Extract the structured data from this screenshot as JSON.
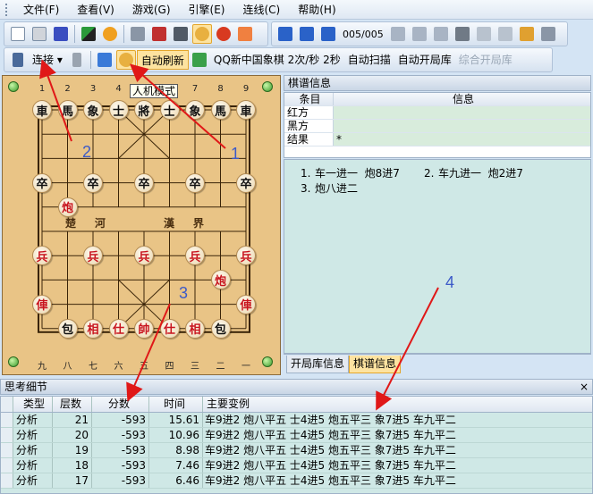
{
  "menu": [
    "文件(F)",
    "查看(V)",
    "游戏(G)",
    "引擎(E)",
    "连线(C)",
    "帮助(H)"
  ],
  "toolbar1": {
    "icons": [
      "new-icon",
      "open-icon",
      "save-icon",
      "board-flip-icon",
      "clock-icon",
      "window-icon",
      "window2-icon",
      "window3-icon",
      "zoom-icon",
      "stop-icon",
      "pause-icon"
    ]
  },
  "nav": {
    "counter": "005/005",
    "icons": [
      "first-icon",
      "prev-fast-icon",
      "prev-icon",
      "next-icon",
      "next-fast-icon",
      "last-icon",
      "tool-icon",
      "copy-icon",
      "paste-icon",
      "paste2-icon",
      "settings-icon"
    ]
  },
  "toolbar2": {
    "connect_label": "连接",
    "auto_refresh": "自动刷新",
    "qq_status": "QQ新中国象棋 2次/秒 2秒",
    "auto_scan": "自动扫描",
    "auto_open_book": "自动开局库",
    "combined_book": "综合开局库"
  },
  "board": {
    "tooltip": "人机模式",
    "top_files": [
      "1",
      "2",
      "3",
      "4",
      "5",
      "6",
      "7",
      "8",
      "9"
    ],
    "bottom_files": [
      "九",
      "八",
      "七",
      "六",
      "五",
      "四",
      "三",
      "二",
      "一"
    ],
    "river_left": [
      "楚",
      "河"
    ],
    "river_right": [
      "漢",
      "界"
    ],
    "pieces": [
      {
        "t": "車",
        "c": "black",
        "f": 0,
        "r": 0
      },
      {
        "t": "馬",
        "c": "black",
        "f": 1,
        "r": 0
      },
      {
        "t": "象",
        "c": "black",
        "f": 2,
        "r": 0
      },
      {
        "t": "士",
        "c": "black",
        "f": 3,
        "r": 0
      },
      {
        "t": "將",
        "c": "black",
        "f": 4,
        "r": 0
      },
      {
        "t": "士",
        "c": "black",
        "f": 5,
        "r": 0
      },
      {
        "t": "象",
        "c": "black",
        "f": 6,
        "r": 0
      },
      {
        "t": "馬",
        "c": "black",
        "f": 7,
        "r": 0
      },
      {
        "t": "車",
        "c": "black",
        "f": 8,
        "r": 0
      },
      {
        "t": "卒",
        "c": "black",
        "f": 0,
        "r": 3
      },
      {
        "t": "卒",
        "c": "black",
        "f": 2,
        "r": 3
      },
      {
        "t": "卒",
        "c": "black",
        "f": 4,
        "r": 3
      },
      {
        "t": "卒",
        "c": "black",
        "f": 6,
        "r": 3
      },
      {
        "t": "卒",
        "c": "black",
        "f": 8,
        "r": 3
      },
      {
        "t": "炮",
        "c": "red",
        "f": 1,
        "r": 4
      },
      {
        "t": "兵",
        "c": "red",
        "f": 0,
        "r": 6
      },
      {
        "t": "兵",
        "c": "red",
        "f": 2,
        "r": 6
      },
      {
        "t": "兵",
        "c": "red",
        "f": 4,
        "r": 6
      },
      {
        "t": "兵",
        "c": "red",
        "f": 6,
        "r": 6
      },
      {
        "t": "兵",
        "c": "red",
        "f": 8,
        "r": 6
      },
      {
        "t": "炮",
        "c": "red",
        "f": 7,
        "r": 7
      },
      {
        "t": "俥",
        "c": "red",
        "f": 0,
        "r": 8
      },
      {
        "t": "俥",
        "c": "red",
        "f": 8,
        "r": 8
      },
      {
        "t": "包",
        "c": "black",
        "f": 1,
        "r": 9
      },
      {
        "t": "相",
        "c": "red",
        "f": 2,
        "r": 9
      },
      {
        "t": "仕",
        "c": "red",
        "f": 3,
        "r": 9
      },
      {
        "t": "帥",
        "c": "red",
        "f": 4,
        "r": 9
      },
      {
        "t": "仕",
        "c": "red",
        "f": 5,
        "r": 9
      },
      {
        "t": "相",
        "c": "red",
        "f": 6,
        "r": 9
      },
      {
        "t": "包",
        "c": "black",
        "f": 7,
        "r": 9
      }
    ]
  },
  "record": {
    "title": "棋谱信息",
    "head_a": "条目",
    "head_b": "信息",
    "rows": [
      {
        "a": "红方",
        "b": ""
      },
      {
        "a": "黑方",
        "b": ""
      },
      {
        "a": "结果",
        "b": "*"
      }
    ],
    "moves": [
      {
        "n1": "1.",
        "m1": "车一进一",
        "m2": "炮8进7",
        "n2": "2.",
        "m3": "车九进一",
        "m4": "炮2进7"
      },
      {
        "n1": "3.",
        "m1": "炮八进二",
        "m2": "",
        "n2": "",
        "m3": "",
        "m4": ""
      }
    ],
    "tabs": [
      "开局库信息",
      "棋谱信息"
    ]
  },
  "analysis": {
    "title": "思考细节",
    "close": "×",
    "headers": [
      "类型",
      "层数",
      "分数",
      "时间",
      "主要变例"
    ],
    "rows": [
      {
        "type": "分析",
        "depth": "21",
        "score": "-593",
        "time": "15.61",
        "pv": "车9进2 炮八平五 士4进5 炮五平三 象7进5 车九平二"
      },
      {
        "type": "分析",
        "depth": "20",
        "score": "-593",
        "time": "10.96",
        "pv": "车9进2 炮八平五 士4进5 炮五平三 象7进5 车九平二"
      },
      {
        "type": "分析",
        "depth": "19",
        "score": "-593",
        "time": "8.98",
        "pv": "车9进2 炮八平五 士4进5 炮五平三 象7进5 车九平二"
      },
      {
        "type": "分析",
        "depth": "18",
        "score": "-593",
        "time": "7.46",
        "pv": "车9进2 炮八平五 士4进5 炮五平三 象7进5 车九平二"
      },
      {
        "type": "分析",
        "depth": "17",
        "score": "-593",
        "time": "6.46",
        "pv": "车9进2 炮八平五 士4进5 炮五平三 象7进5 车九平二"
      }
    ]
  },
  "annotations": [
    "1",
    "2",
    "3",
    "4"
  ],
  "colors": {
    "annotation": "#3c5ac8",
    "red_piece": "#c8141e",
    "board": "#e9c486",
    "panel": "#cfe8e6"
  }
}
